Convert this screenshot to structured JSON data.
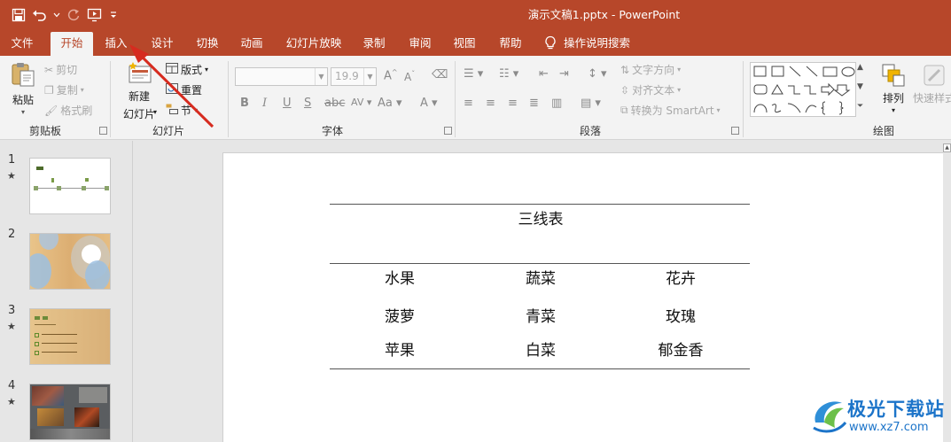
{
  "window": {
    "title": "演示文稿1.pptx  -  PowerPoint",
    "accent": "#b7472a"
  },
  "qat": [
    "save-icon",
    "undo-icon",
    "redo-icon",
    "slideshow-from-start-icon",
    "customize-qat-icon"
  ],
  "tabs": [
    "文件",
    "开始",
    "插入",
    "设计",
    "切换",
    "动画",
    "幻灯片放映",
    "录制",
    "审阅",
    "视图",
    "帮助"
  ],
  "tell_me": "操作说明搜索",
  "ribbon": {
    "clipboard": {
      "paste": "粘贴",
      "cut": "剪切",
      "copy": "复制",
      "format_painter": "格式刷",
      "label": "剪贴板"
    },
    "slides": {
      "new_slide_line1": "新建",
      "new_slide_line2": "幻灯片",
      "layout": "版式",
      "reset": "重置",
      "section": "节",
      "label": "幻灯片"
    },
    "font": {
      "font_name": "",
      "font_size": "19.9",
      "label": "字体",
      "bold": "B",
      "italic": "I",
      "underline": "U",
      "strike": "S",
      "spacing": "AV",
      "case": "Aa",
      "color": "A"
    },
    "paragraph": {
      "text_direction": "文字方向",
      "align_text": "对齐文本",
      "smartart": "转换为 SmartArt",
      "label": "段落"
    },
    "drawing": {
      "arrange": "排列",
      "quick_styles": "快速样式",
      "label": "绘图"
    }
  },
  "slides_panel": [
    {
      "num": "1",
      "star": "★"
    },
    {
      "num": "2",
      "star": ""
    },
    {
      "num": "3",
      "star": "★"
    },
    {
      "num": "4",
      "star": "★"
    }
  ],
  "slide": {
    "caption": "三线表",
    "headers": [
      "水果",
      "蔬菜",
      "花卉"
    ],
    "rows": [
      [
        "菠萝",
        "青菜",
        "玫瑰"
      ],
      [
        "苹果",
        "白菜",
        "郁金香"
      ]
    ]
  },
  "watermark": {
    "text": "极光下载站",
    "url": "www.xz7.com"
  }
}
